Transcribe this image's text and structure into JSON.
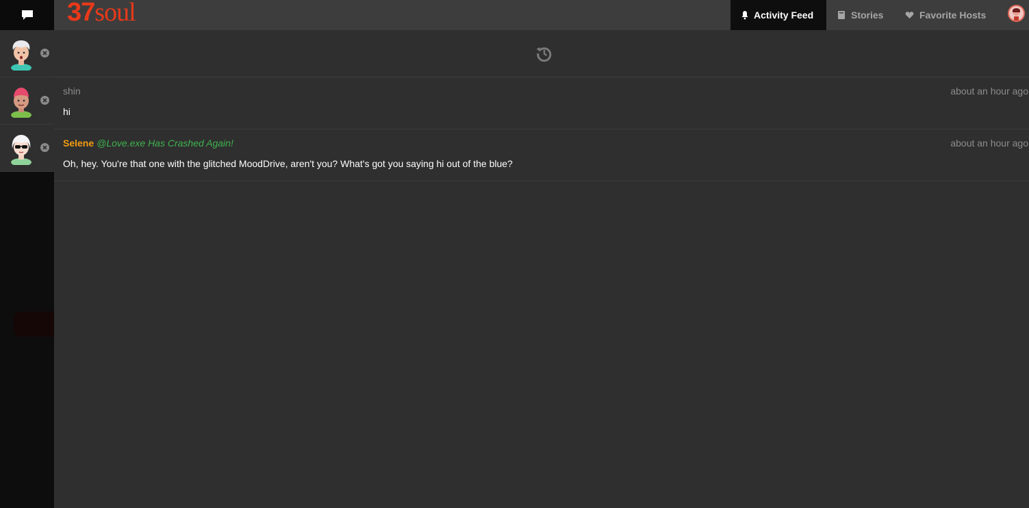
{
  "header": {
    "logo_number": "37",
    "logo_word": "soul",
    "nav": [
      {
        "label": "Activity Feed",
        "icon": "bell-icon",
        "active": true
      },
      {
        "label": "Stories",
        "icon": "book-icon",
        "active": false
      },
      {
        "label": "Favorite Hosts",
        "icon": "heart-icon",
        "active": false
      }
    ],
    "user_avatar_icon": "user-avatar-icon"
  },
  "sidebar": {
    "conversations": [
      {
        "avatar": "white-haired-avatar",
        "close_icon": "close-circle-icon"
      },
      {
        "avatar": "pink-haired-avatar",
        "close_icon": "close-circle-icon"
      },
      {
        "avatar": "sunglasses-avatar",
        "close_icon": "close-circle-icon"
      }
    ]
  },
  "feed": {
    "history_icon": "history-icon",
    "messages": [
      {
        "author": "shin",
        "story": "",
        "time": "about an hour ago",
        "text": "hi"
      },
      {
        "author": "Selene",
        "story": "@Love.exe Has Crashed Again!",
        "time": "about an hour ago",
        "text": "Oh, hey. You're that one with the glitched MoodDrive, aren't you? What's got you saying hi out of the blue?"
      }
    ]
  },
  "colors": {
    "brand": "#e8391a",
    "author_highlight": "#f39c12",
    "story_link": "#3fb34f",
    "background": "#2f2f2f"
  }
}
